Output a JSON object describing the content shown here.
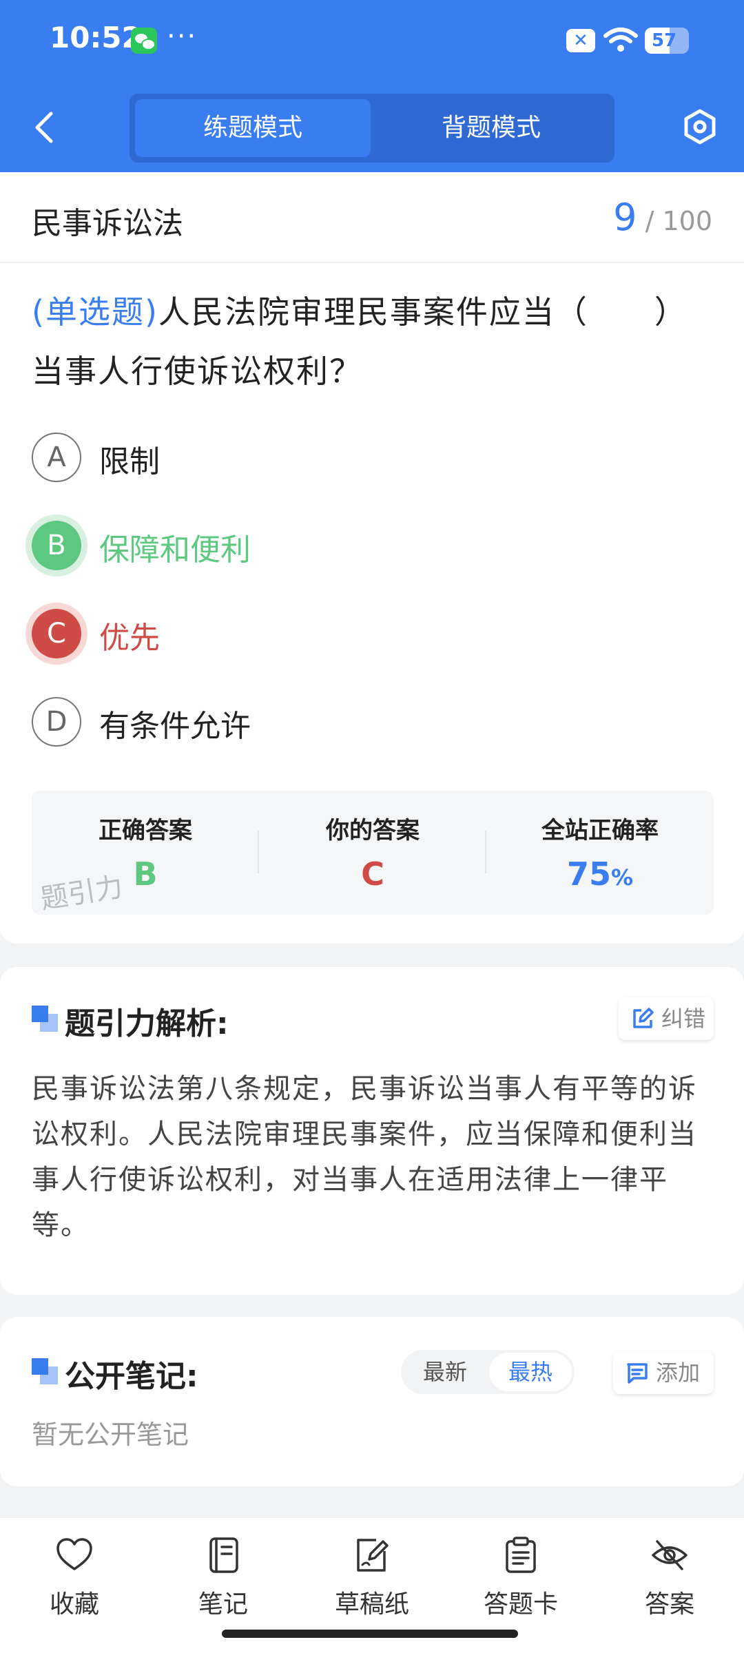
{
  "status_bar": {
    "time": "10:52",
    "more": "···",
    "battery": "57",
    "battery_level": 0.57
  },
  "header": {
    "tabs": [
      {
        "label": "练题模式",
        "active": true
      },
      {
        "label": "背题模式",
        "active": false
      }
    ]
  },
  "question_card": {
    "subject": "民事诉讼法",
    "progress_current": "9",
    "progress_total": "/ 100",
    "question_type": "(单选题)",
    "question_text": "人民法院审理民事案件应当（　　）当事人行使诉讼权利？",
    "options": [
      {
        "letter": "A",
        "text": "限制",
        "state": "normal"
      },
      {
        "letter": "B",
        "text": "保障和便利",
        "state": "correct"
      },
      {
        "letter": "C",
        "text": "优先",
        "state": "wrong"
      },
      {
        "letter": "D",
        "text": "有条件允许",
        "state": "normal"
      }
    ],
    "answer_summary": {
      "correct_label": "正确答案",
      "correct_value": "B",
      "yours_label": "你的答案",
      "yours_value": "C",
      "rate_label": "全站正确率",
      "rate_value": "75",
      "rate_unit": "%"
    },
    "watermark": "题引力"
  },
  "analysis": {
    "title": "题引力解析:",
    "report_label": "纠错",
    "text": "民事诉讼法第八条规定，民事诉讼当事人有平等的诉讼权利。人民法院审理民事案件，应当保障和便利当事人行使诉讼权利，对当事人在适用法律上一律平等。"
  },
  "notes": {
    "title": "公开笔记:",
    "sort_options": [
      "最新",
      "最热"
    ],
    "active_sort": "最热",
    "add_label": "添加",
    "empty_text": "暂无公开笔记"
  },
  "bottom_nav": [
    {
      "label": "收藏",
      "icon": "heart-icon"
    },
    {
      "label": "笔记",
      "icon": "notebook-icon"
    },
    {
      "label": "草稿纸",
      "icon": "draft-paper-icon"
    },
    {
      "label": "答题卡",
      "icon": "answer-card-icon"
    },
    {
      "label": "答案",
      "icon": "eye-off-icon"
    }
  ],
  "colors": {
    "primary": "#3a7df0",
    "correct": "#5cc880",
    "wrong": "#cf4b46"
  }
}
